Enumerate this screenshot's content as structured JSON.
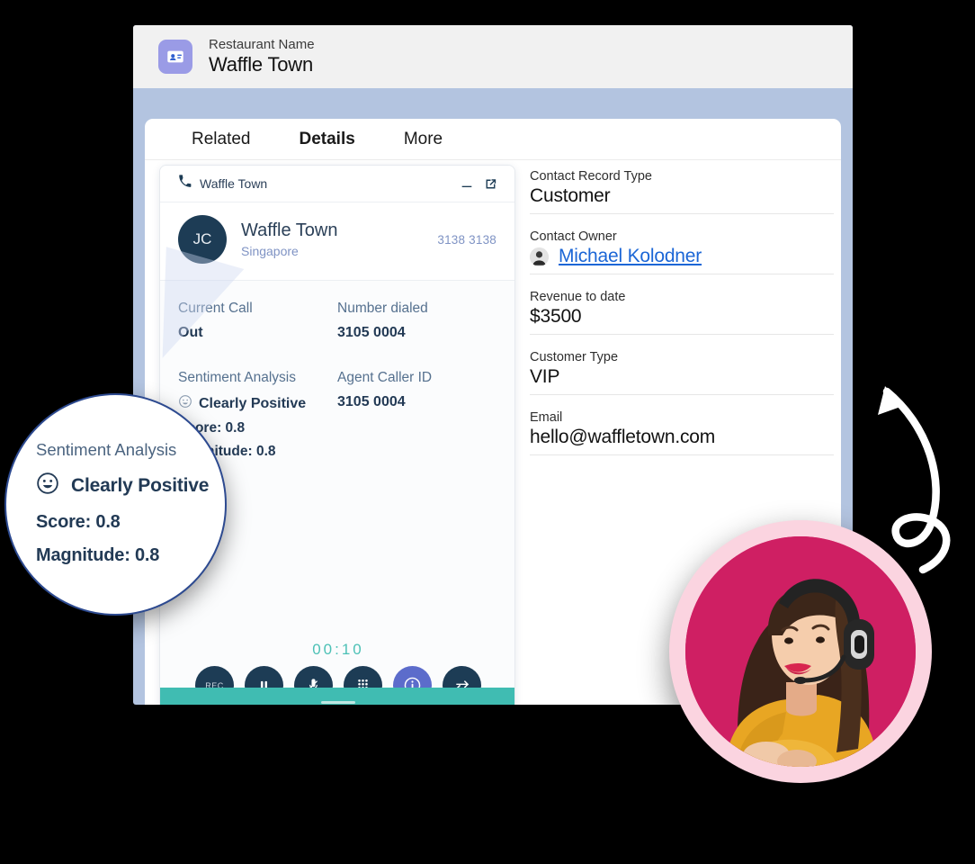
{
  "window": {
    "brand": {
      "label": "Restaurant Name",
      "title": "Waffle Town",
      "icon": "contact-card-icon",
      "icon_color": "#9a9be6"
    },
    "frame_color": "#b3c4e0",
    "topbar_color": "#f1f1f1"
  },
  "tabs": [
    {
      "label": "Related",
      "active": false
    },
    {
      "label": "Details",
      "active": true
    },
    {
      "label": "More",
      "active": false
    }
  ],
  "call_panel": {
    "header": {
      "icon": "phone-icon",
      "title": "Waffle Town",
      "minimize_icon": "minimize-icon",
      "popout_icon": "external-link-icon"
    },
    "contact": {
      "avatar_initials": "JC",
      "avatar_color": "#1d3c55",
      "name": "Waffle Town",
      "location": "Singapore",
      "number": "3138 3138",
      "number_color": "#7f93c4"
    },
    "fields": {
      "current_call_label": "Current Call",
      "current_call_value": "Out",
      "number_dialed_label": "Number dialed",
      "number_dialed_value": "3105 0004",
      "sentiment_label": "Sentiment Analysis",
      "sentiment_value": "Clearly Positive",
      "sentiment_icon": "smiley-face-icon",
      "sentiment_score": "Score: 0.8",
      "sentiment_magnitude": "Magnitude: 0.8",
      "agent_caller_id_label": "Agent Caller ID",
      "agent_caller_id_value": "3105 0004"
    },
    "timer": "00:10",
    "timer_color": "#4cc1b6",
    "controls": [
      {
        "name": "record-button",
        "icon": "rec-icon",
        "label": "REC",
        "active": false
      },
      {
        "name": "pause-button",
        "icon": "pause-icon",
        "label": "",
        "active": false
      },
      {
        "name": "mute-button",
        "icon": "mic-off-icon",
        "label": "",
        "active": false
      },
      {
        "name": "keypad-button",
        "icon": "dialpad-icon",
        "label": "",
        "active": false
      },
      {
        "name": "info-button",
        "icon": "info-icon",
        "label": "",
        "active": true
      },
      {
        "name": "transfer-button",
        "icon": "transfer-arrows-icon",
        "label": "",
        "active": false
      }
    ],
    "hangup": {
      "name": "hangup-button",
      "icon": "hangup-phone-icon",
      "color": "#f8213a"
    },
    "footer_color": "#40bcb2",
    "accent_color": "#5c6ccb"
  },
  "details": {
    "fields": [
      {
        "label": "Contact Record Type",
        "value": "Customer",
        "type": "text"
      },
      {
        "label": "Contact Owner",
        "value": "Michael Kolodner",
        "type": "link"
      },
      {
        "label": "Revenue to date",
        "value": "$3500",
        "type": "text"
      },
      {
        "label": "Customer Type",
        "value": "VIP",
        "type": "text"
      },
      {
        "label": "Email",
        "value": "hello@waffletown.com",
        "type": "text"
      }
    ],
    "link_color": "#1b66d6"
  },
  "magnifier": {
    "title": "Sentiment Analysis",
    "icon": "smiley-face-icon",
    "sentiment": "Clearly Positive",
    "score": "Score: 0.8",
    "magnitude": "Magnitude: 0.8",
    "border_color": "#2d4a90"
  },
  "agent_photo": {
    "alt": "call-center-agent-with-headset",
    "ring_color": "#fbd4e0",
    "background_color": "#cf1f63"
  },
  "arrow": {
    "name": "curved-up-arrow",
    "color": "#ffffff"
  }
}
